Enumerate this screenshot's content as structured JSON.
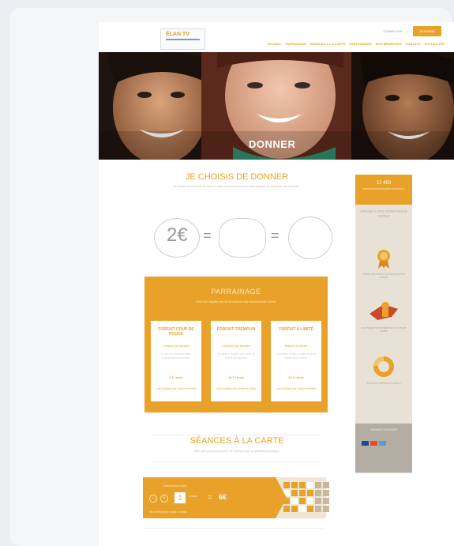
{
  "header": {
    "logo": "ÉLAN TV",
    "login": "CONNEXION",
    "donate": "JE DONNE",
    "nav": [
      "ACCUEIL",
      "PARRAINAGE",
      "SÉANCES À LA CARTE",
      "PARTENAIRES",
      "NOS BÉNÉFICES",
      "CONTACT",
      "ACTUALITÉS"
    ]
  },
  "hero": {
    "title": "DONNER"
  },
  "main": {
    "heading": "JE CHOISIS DE DONNER",
    "intro": "Je choisis un montant de don et vous le reversons pour l'aide sportive au bénéfice des enfants.",
    "equation": {
      "amount": "2€",
      "equals": "="
    }
  },
  "parrainage": {
    "title": "PARRAINAGE",
    "subtitle": "Votre don régulier permet de financer des séances toute l'année",
    "plans": [
      {
        "name": "FORFAIT COUP DE POUCE",
        "freq": "1 séance par semaine",
        "desc": "Le don de base pour aider régulièrement un enfant",
        "price": "8 € / mois",
        "link": "voir le détail pour choisir ce forfait"
      },
      {
        "name": "FORFAIT TREMPLIN",
        "freq": "2 séances par semaine",
        "desc": "Un soutien régulier pour aider un enfant à progresser",
        "price": "16 € / mois",
        "link": "voir le détail pour choisir ce forfait"
      },
      {
        "name": "FORFAIT ILLIMITÉ",
        "freq": "séances en illimité",
        "desc": "Le soutien le plus complet pour un enfant toute l'année",
        "price": "24 € / mois",
        "link": "voir le détail pour choisir ce forfait"
      }
    ]
  },
  "seances": {
    "title": "SÉANCES À LA CARTE",
    "subtitle": "Votre don ponctuel permet de financer une ou plusieurs séances",
    "card_label": "Séances à la carte",
    "count": "1",
    "unit": "séance",
    "price": "6€",
    "footnote": "voir le détail pour choisir ce forfait"
  },
  "sidebar": {
    "stat_number": "12 450",
    "stat_caption": "séances financées grâce à vos dons",
    "grace": "GRÂCE À VOS DONS NOUS AVONS",
    "items": [
      {
        "icon": "medal-icon",
        "label": "financé des séances de sport pour les enfants"
      },
      {
        "icon": "hero-icon",
        "label": "accompagné des enfants tout au long de l'année"
      },
      {
        "icon": "donut-chart-icon",
        "label": "des dons reversés aux actions"
      }
    ],
    "payment_title": "PAIEMENT SÉCURISÉ",
    "payment_cards": [
      "visa",
      "mastercard",
      "amex"
    ]
  },
  "colors": {
    "accent": "#e8a22a",
    "sidebar": "#e7e1d6",
    "footer_box": "#b3ada3"
  }
}
